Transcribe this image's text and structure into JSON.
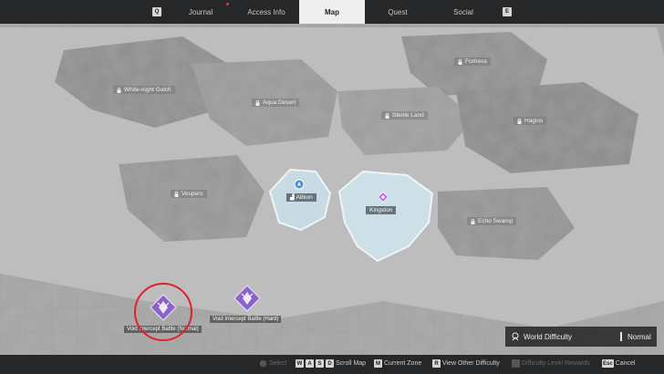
{
  "topbar": {
    "left_key": "Q",
    "right_key": "E",
    "tabs": [
      {
        "label": "Journal"
      },
      {
        "label": "Access Info"
      },
      {
        "label": "Map"
      },
      {
        "label": "Quest"
      },
      {
        "label": "Social"
      }
    ]
  },
  "regions": [
    {
      "name": "White-night Gulch"
    },
    {
      "name": "Aqua Desert"
    },
    {
      "name": "Fortress"
    },
    {
      "name": "Sterile Land"
    },
    {
      "name": "Hagios"
    },
    {
      "name": "Vespers"
    },
    {
      "name": "Echo Swamp"
    }
  ],
  "cities": [
    {
      "name": "Albion"
    },
    {
      "name": "Kingston"
    }
  ],
  "battles": [
    {
      "label": "Void Intercept Battle (Normal)"
    },
    {
      "label": "Void Intercept Battle (Hard)"
    }
  ],
  "world_difficulty": {
    "label": "World Difficulty",
    "level": "Normal"
  },
  "bottombar": {
    "select_label": "Select",
    "scroll_keys": [
      "W",
      "A",
      "S",
      "D"
    ],
    "scroll_label": "Scroll Map",
    "zone_key": "M",
    "zone_label": "Current Zone",
    "view_key": "R",
    "view_label": "View Other Difficulty",
    "rewards_label": "Difficulty Level Rewards",
    "cancel_key": "Esc",
    "cancel_label": "Cancel"
  },
  "colors": {
    "topbar": "#262728",
    "active_tab": "#efefef",
    "battle_purple": "#8a63c9",
    "highlight_red": "#e2202a",
    "city_ice": "#c8dbe4"
  }
}
